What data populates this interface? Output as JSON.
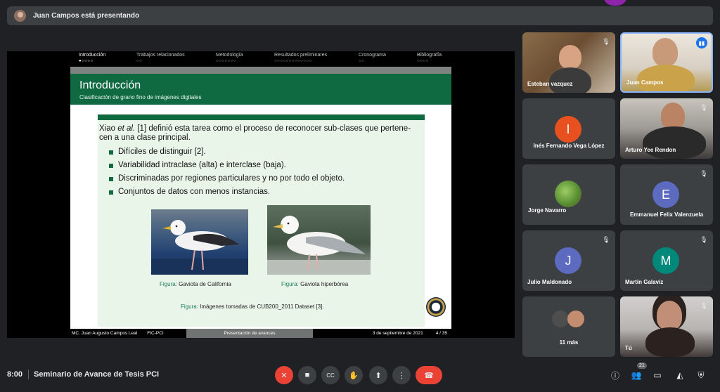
{
  "presenting_bar": {
    "title": "Juan Campos está presentando"
  },
  "slide": {
    "nav": [
      {
        "label": "Introducción",
        "dots": "●○○○○"
      },
      {
        "label": "Trabajos relacionados",
        "dots": "○○"
      },
      {
        "label": "Metodología",
        "dots": "○○○○○○○"
      },
      {
        "label": "Resultados preliminares",
        "dots": "○○○○○○○○○○○○○"
      },
      {
        "label": "Cronograma",
        "dots": "○○"
      },
      {
        "label": "Bibliografía",
        "dots": "○○○○"
      }
    ],
    "title": "Introducción",
    "subtitle": "Clasificación de grano fino de imágenes digitales",
    "para_prefix": "Xiao ",
    "para_italic": "et al.",
    "para_rest": " [1] definió esta tarea como el proceso de reconocer sub-clases que pertene- cen a una clase principal.",
    "bullets": [
      "Difíciles de distinguir [2].",
      "Variabilidad intraclase (alta) e interclase (baja).",
      "Discriminadas por regiones particulares y no por todo el objeto.",
      "Conjuntos de datos con menos instancias."
    ],
    "figure_label": "Figura:",
    "caption1": "Gaviota de California",
    "caption2": "Gaviota hiperbórea",
    "caption_main": "Imágenes tomadas de CUB200_2011 Dataset [3].",
    "footer_author": "MC. Juan Augusto Campos Leal",
    "footer_org": "FIC-PCI",
    "footer_center": "Presentación de avances",
    "footer_date": "3 de septiembre de 2021",
    "footer_page": "4 / 35"
  },
  "participants": [
    {
      "name": "Esteban vazquez"
    },
    {
      "name": "Juan Campos"
    },
    {
      "name": "Inés Fernando Vega López",
      "initial": "I",
      "color": "#e8501f"
    },
    {
      "name": "Arturo Yee Rendon"
    },
    {
      "name": "Jorge Navarro"
    },
    {
      "name": "Emmanuel Felix Valenzuela",
      "initial": "E",
      "color": "#5c6bc0"
    },
    {
      "name": "Julio Maldonado",
      "initial": "J",
      "color": "#5c6bc0"
    },
    {
      "name": "Martin Galaviz",
      "initial": "M",
      "color": "#00897b"
    },
    {
      "name": "11 más"
    },
    {
      "name": "Tú"
    }
  ],
  "bottom_bar": {
    "time": "8:00",
    "meeting": "Seminario de Avance de Tesis PCI",
    "participant_count": "21"
  },
  "icons": {
    "mic_off": "mic-off-icon",
    "camera": "camera-icon",
    "captions": "captions-icon",
    "hand": "raise-hand-icon",
    "present": "present-icon",
    "more": "more-options-icon",
    "end_call": "end-call-icon",
    "info": "info-icon",
    "people": "people-icon",
    "chat": "chat-icon",
    "activities": "activities-icon",
    "shield": "host-controls-icon"
  }
}
